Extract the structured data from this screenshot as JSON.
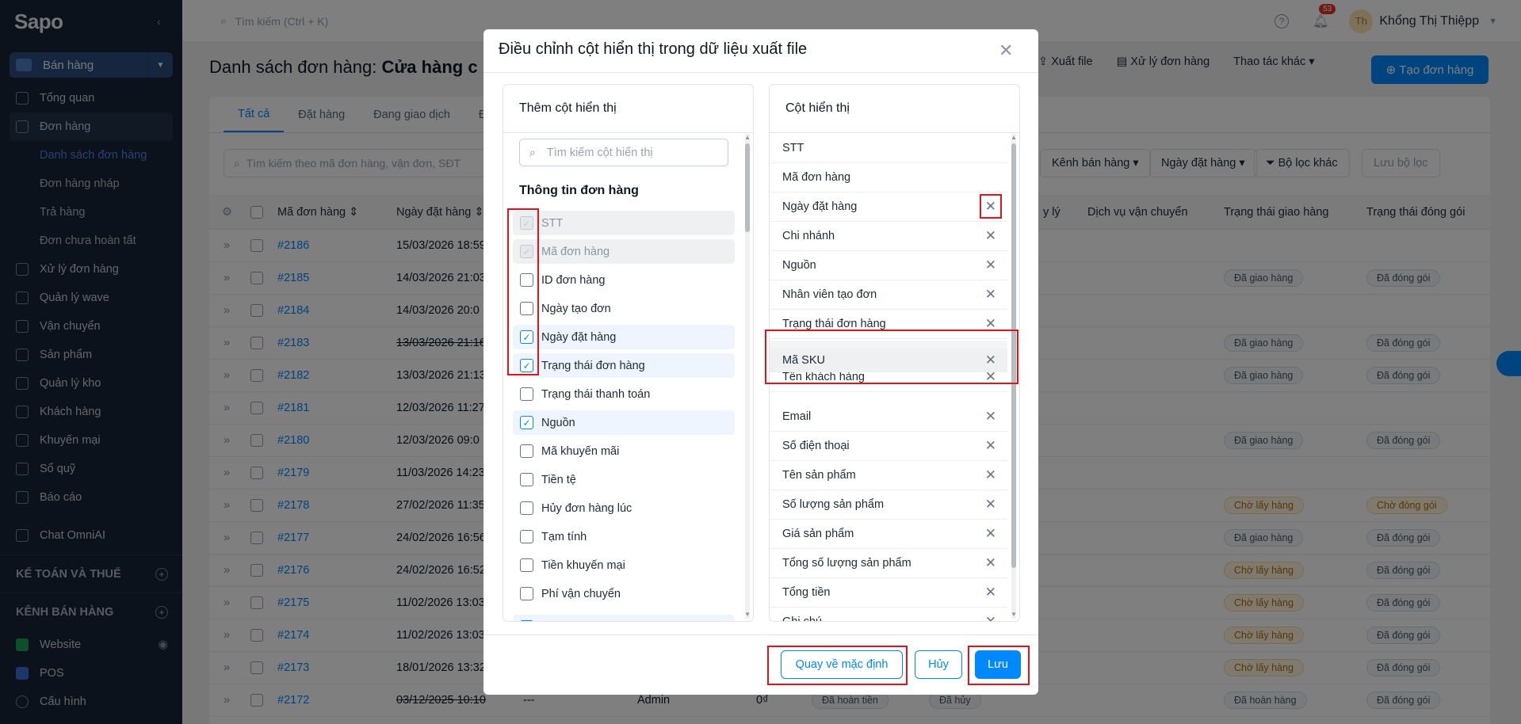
{
  "sidebar": {
    "logo": "Sapo",
    "sell_button": "Bán hàng",
    "items": [
      {
        "label": "Tổng quan"
      },
      {
        "label": "Đơn hàng"
      }
    ],
    "sub_items": [
      {
        "label": "Danh sách đơn hàng"
      },
      {
        "label": "Đơn hàng nháp"
      },
      {
        "label": "Trả hàng"
      },
      {
        "label": "Đơn chưa hoàn tất"
      }
    ],
    "items2": [
      {
        "label": "Xử lý đơn hàng"
      },
      {
        "label": "Quản lý wave"
      },
      {
        "label": "Vận chuyển"
      },
      {
        "label": "Sản phẩm"
      },
      {
        "label": "Quản lý kho"
      },
      {
        "label": "Khách hàng"
      },
      {
        "label": "Khuyến mại"
      },
      {
        "label": "Sổ quỹ"
      },
      {
        "label": "Báo cáo"
      }
    ],
    "chat": "Chat OmniAI",
    "section_accounting": "KẾ TOÁN VÀ THUẾ",
    "section_channels": "KÊNH BÁN HÀNG",
    "website": "Website",
    "pos": "POS",
    "config": "Cấu hình"
  },
  "topbar": {
    "search_placeholder": "Tìm kiếm (Ctrl + K)",
    "notif_count": "53",
    "avatar": "Th",
    "user_name": "Khổng Thị Thiệpp"
  },
  "page": {
    "title": "Danh sách đơn hàng:",
    "store": "Cửa hàng c",
    "export": "Xuất file",
    "process": "Xử lý đơn hàng",
    "actions": "Thao tác khác",
    "create": "Tạo đơn hàng",
    "tabs": [
      "Tất cả",
      "Đặt hàng",
      "Đang giao dịch",
      "Đ"
    ],
    "search_placeholder": "Tìm kiếm theo mã đơn hàng, vận đơn, SĐT",
    "filter_channel": "Kênh bán hàng",
    "filter_date": "Ngày đặt hàng",
    "filter_other": "Bộ lọc khác",
    "save_filter": "Lưu bộ lọc",
    "columns": [
      "Mã đơn hàng",
      "Ngày đặt hàng",
      "y lý",
      "Dịch vụ vận chuyển",
      "Trạng thái giao hàng",
      "Trạng thái đóng gói"
    ],
    "rows": [
      {
        "code": "#2186",
        "date": "15/03/2026 18:59",
        "ship": "",
        "pack": ""
      },
      {
        "code": "#2185",
        "date": "14/03/2026 21:03",
        "ship": "Đã giao hàng",
        "pack": "Đã đóng gói"
      },
      {
        "code": "#2184",
        "date": "14/03/2026 20:0",
        "ship": "",
        "pack": ""
      },
      {
        "code": "#2183",
        "date": "13/03/2026 21:16",
        "ship": "Đã giao hàng",
        "pack": "Đã đóng gói"
      },
      {
        "code": "#2182",
        "date": "13/03/2026 21:13",
        "ship": "Đã giao hàng",
        "pack": "Đã đóng gói"
      },
      {
        "code": "#2181",
        "date": "12/03/2026 11:27",
        "ship": "",
        "pack": ""
      },
      {
        "code": "#2180",
        "date": "12/03/2026 09:0",
        "ship": "Đã giao hàng",
        "pack": "Đã đóng gói"
      },
      {
        "code": "#2179",
        "date": "11/03/2026 14:23",
        "ship": "",
        "pack": ""
      },
      {
        "code": "#2178",
        "date": "27/02/2026 11:35",
        "ship": "Chờ lấy hàng",
        "pack": "Chờ đóng gói"
      },
      {
        "code": "#2177",
        "date": "24/02/2026 16:56",
        "ship": "Đã giao hàng",
        "pack": "Đã đóng gói"
      },
      {
        "code": "#2176",
        "date": "24/02/2026 16:52",
        "ship": "Chờ lấy hàng",
        "pack": "Đã đóng gói"
      },
      {
        "code": "#2175",
        "date": "11/02/2026 13:03",
        "ship": "Chờ lấy hàng",
        "pack": "Đã đóng gói"
      },
      {
        "code": "#2174",
        "date": "11/02/2026 13:03",
        "ship": "Chờ lấy hàng",
        "pack": "Đã đóng gói"
      },
      {
        "code": "#2173",
        "date": "18/01/2026 13:32",
        "ship": "Chờ lấy hàng",
        "pack": "Đã đóng gói"
      },
      {
        "code": "#2172",
        "date": "03/12/2025 10:10",
        "ship": "Đã hoàn hàng",
        "pack": "Đã đóng gói",
        "extra1": "---",
        "extra2": "Admin",
        "extra3": "0₫",
        "extra4": "Đã hoàn tiền",
        "extra5": "Đã hủy"
      }
    ]
  },
  "modal": {
    "title": "Điều chỉnh cột hiển thị trong dữ liệu xuất file",
    "add_title": "Thêm cột hiển thị",
    "search_placeholder": "Tìm kiếm cột hiển thị",
    "group_title": "Thông tin đơn hàng",
    "options": [
      {
        "label": "STT",
        "state": "disabled"
      },
      {
        "label": "Mã đơn hàng",
        "state": "disabled"
      },
      {
        "label": "ID đơn hàng",
        "state": "off"
      },
      {
        "label": "Ngày tạo đơn",
        "state": "off"
      },
      {
        "label": "Ngày đặt hàng",
        "state": "on"
      },
      {
        "label": "Trạng thái đơn hàng",
        "state": "on"
      },
      {
        "label": "Trạng thái thanh toán",
        "state": "off"
      },
      {
        "label": "Nguồn",
        "state": "on"
      },
      {
        "label": "Mã khuyến mãi",
        "state": "off"
      },
      {
        "label": "Tiền tệ",
        "state": "off"
      },
      {
        "label": "Hủy đơn hàng lúc",
        "state": "off"
      },
      {
        "label": "Tạm tính",
        "state": "off"
      },
      {
        "label": "Tiền khuyến mại",
        "state": "off"
      },
      {
        "label": "Phí vận chuyển",
        "state": "off"
      }
    ],
    "visible_title": "Cột hiển thị",
    "visible": [
      {
        "label": "STT",
        "removable": false
      },
      {
        "label": "Mã đơn hàng",
        "removable": false
      },
      {
        "label": "Ngày đặt hàng",
        "removable": true
      },
      {
        "label": "Chi nhánh",
        "removable": true
      },
      {
        "label": "Nguồn",
        "removable": true
      },
      {
        "label": "Nhân viên tạo đơn",
        "removable": true
      },
      {
        "label": "Trạng thái đơn hàng",
        "removable": true
      }
    ],
    "dragging": "Mã SKU",
    "hidden_under": "Tên khách hàng",
    "visible_after": [
      {
        "label": "Email"
      },
      {
        "label": "Số điện thoại"
      },
      {
        "label": "Tên sản phẩm"
      },
      {
        "label": "Số lượng sản phẩm"
      },
      {
        "label": "Giá sản phẩm"
      },
      {
        "label": "Tổng số lượng sản phẩm"
      },
      {
        "label": "Tổng tiền"
      },
      {
        "label": "Ghi chú"
      }
    ],
    "reset": "Quay về mặc định",
    "cancel": "Hủy",
    "save": "Lưu"
  },
  "colors": {
    "primary": "#0088ff",
    "sidebar": "#182537",
    "highlight": "#e3131c"
  }
}
